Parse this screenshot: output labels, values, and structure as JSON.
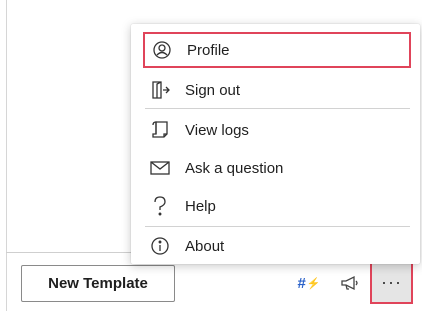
{
  "footer": {
    "new_template_label": "New Template",
    "more_label": "···"
  },
  "menu": {
    "items": [
      {
        "label": "Profile",
        "icon": "profile-icon"
      },
      {
        "label": "Sign out",
        "icon": "sign-out-icon"
      },
      {
        "label": "View logs",
        "icon": "logs-icon"
      },
      {
        "label": "Ask a question",
        "icon": "mail-icon"
      },
      {
        "label": "Help",
        "icon": "help-icon"
      },
      {
        "label": "About",
        "icon": "info-icon"
      }
    ],
    "selected_index": 0
  },
  "colors": {
    "highlight": "#e0445a",
    "hash_icon": "#2b62c9",
    "more_button_bg": "#e5e5e5"
  }
}
